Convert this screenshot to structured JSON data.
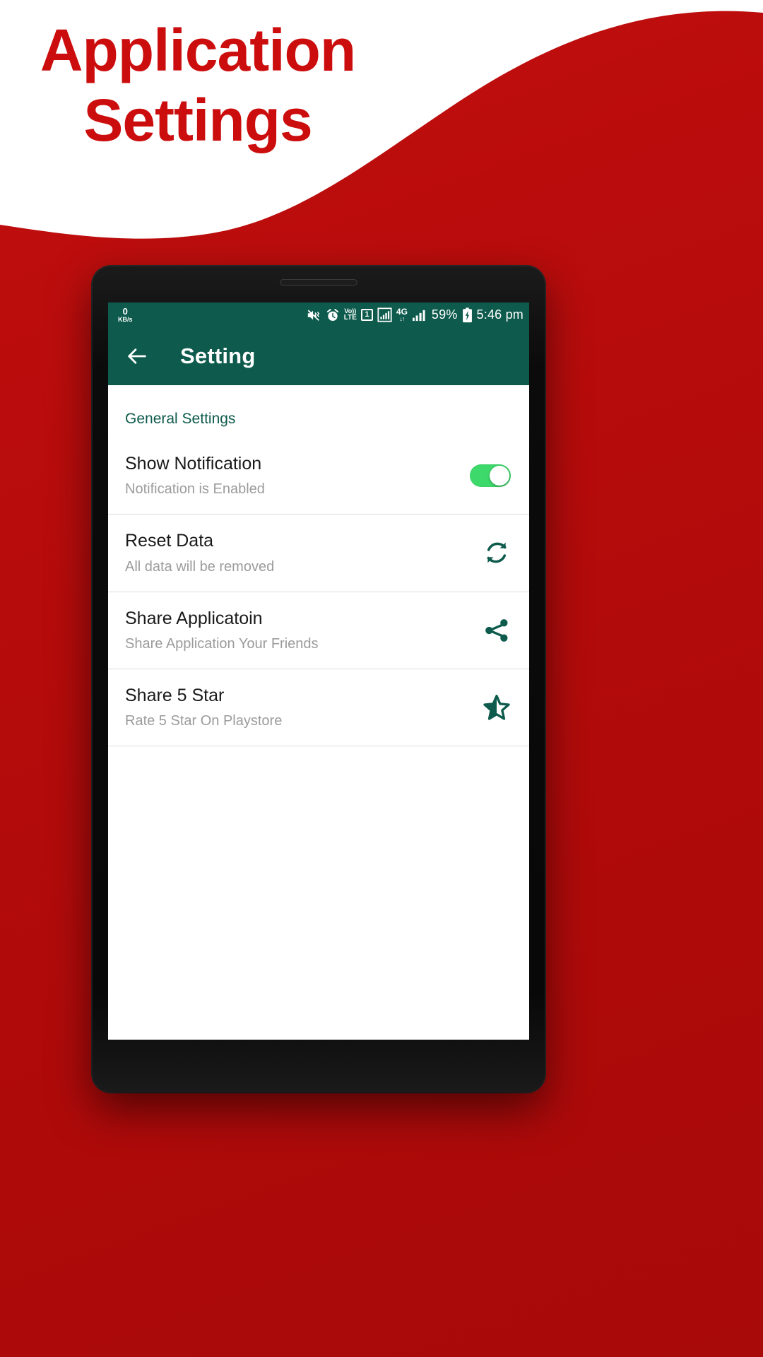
{
  "promo": {
    "headline_lines": [
      "Application",
      "Settings"
    ],
    "headline_color": "#CC0D0D",
    "background_color": "#C10D0D",
    "wave_color": "#ffffff"
  },
  "phone": {
    "statusbar": {
      "background": "#0E5B4D",
      "net_speed_value": "0",
      "net_speed_unit": "KB/s",
      "icons": [
        "mute-vibrate-icon",
        "alarm-icon",
        "volte-icon",
        "sim-icon",
        "signal-boxed-icon",
        "network-4g-icon",
        "signal-bars-icon"
      ],
      "volte_top": "Vo))",
      "volte_bottom": "LTE",
      "sim_label": "1",
      "network_label": "4G",
      "battery_percent": "59%",
      "battery_icon": "battery-charging-icon",
      "time": "5:46 pm"
    },
    "appbar": {
      "background": "#0E5B4D",
      "back_icon": "back-arrow-icon",
      "title": "Setting"
    },
    "section_header": "General Settings",
    "rows": [
      {
        "title": "Show Notification",
        "subtitle": "Notification is Enabled",
        "control": "toggle",
        "toggle_on": true,
        "toggle_color": "#3ED96B",
        "icon_name": "notification-toggle"
      },
      {
        "title": "Reset Data",
        "subtitle": "All data will be removed",
        "control": "icon",
        "icon_name": "refresh-sync-icon",
        "icon_color": "#0E5B4D"
      },
      {
        "title": "Share Applicatoin",
        "subtitle": "Share Application Your Friends",
        "control": "icon",
        "icon_name": "share-icon",
        "icon_color": "#0E5B4D"
      },
      {
        "title": "Share 5 Star",
        "subtitle": "Rate 5 Star On Playstore",
        "control": "icon",
        "icon_name": "star-half-icon",
        "icon_color": "#0E5B4D"
      }
    ]
  }
}
